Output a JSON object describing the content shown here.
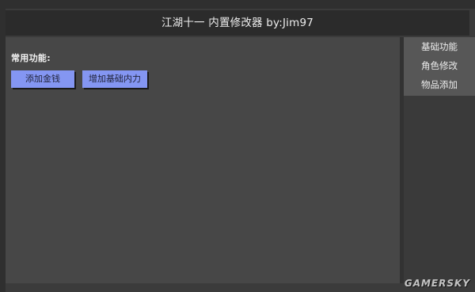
{
  "window": {
    "title": "江湖十一 内置修改器 by:Jim97"
  },
  "main": {
    "section_label": "常用功能:",
    "buttons": [
      {
        "label": "添加金钱"
      },
      {
        "label": "增加基础内力"
      }
    ]
  },
  "sidebar": {
    "tabs": [
      {
        "label": "基础功能"
      },
      {
        "label": "角色修改"
      },
      {
        "label": "物品添加"
      }
    ]
  },
  "watermark": {
    "text": "GAMERSKY"
  }
}
